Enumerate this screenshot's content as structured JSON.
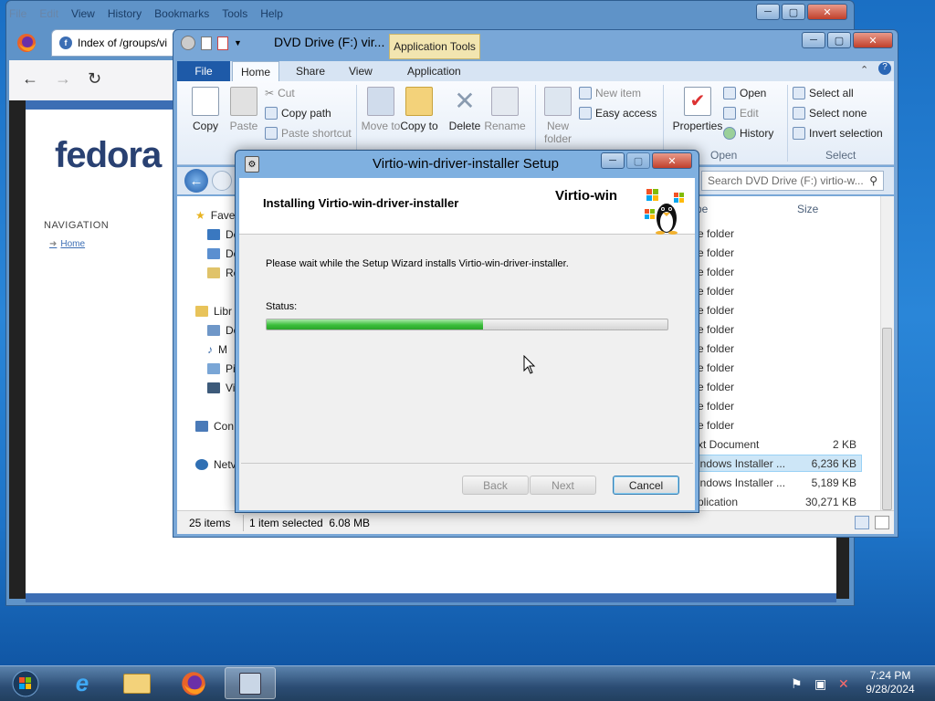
{
  "firefox": {
    "menu": [
      "File",
      "Edit",
      "View",
      "History",
      "Bookmarks",
      "Tools",
      "Help"
    ],
    "tab_title": "Index of /groups/vi",
    "logo_text": "fedora",
    "nav_heading": "NAVIGATION",
    "nav_home": "Home"
  },
  "explorer": {
    "title": "DVD Drive (F:) vir...",
    "app_tools": "Application Tools",
    "tabs": {
      "file": "File",
      "home": "Home",
      "share": "Share",
      "view": "View",
      "application": "Application"
    },
    "ribbon": {
      "copy": "Copy",
      "paste": "Paste",
      "cut": "Cut",
      "copy_path": "Copy path",
      "paste_shortcut": "Paste shortcut",
      "move_to": "Move to",
      "copy_to": "Copy to",
      "delete": "Delete",
      "rename": "Rename",
      "new_folder": "New folder",
      "new_item": "New item",
      "easy_access": "Easy access",
      "properties": "Properties",
      "open": "Open",
      "edit": "Edit",
      "history": "History",
      "select_all": "Select all",
      "select_none": "Select none",
      "invert_selection": "Invert selection",
      "group_open": "Open",
      "group_select": "Select"
    },
    "search_placeholder": "Search DVD Drive (F:) virtio-w...",
    "nav": {
      "favorites": "Fave",
      "desktop": "De",
      "downloads": "Do",
      "recent": "Re",
      "libraries": "Libr",
      "documents": "Do",
      "music": "M",
      "pictures": "Pi",
      "videos": "Vi",
      "computer": "Con",
      "network": "Netv"
    },
    "columns": {
      "type": "pe",
      "size": "Size"
    },
    "rows": [
      {
        "type": "e folder",
        "size": ""
      },
      {
        "type": "e folder",
        "size": ""
      },
      {
        "type": "e folder",
        "size": ""
      },
      {
        "type": "e folder",
        "size": ""
      },
      {
        "type": "e folder",
        "size": ""
      },
      {
        "type": "e folder",
        "size": ""
      },
      {
        "type": "e folder",
        "size": ""
      },
      {
        "type": "e folder",
        "size": ""
      },
      {
        "type": "e folder",
        "size": ""
      },
      {
        "type": "e folder",
        "size": ""
      },
      {
        "type": "e folder",
        "size": ""
      },
      {
        "type": "xt Document",
        "size": "2 KB"
      },
      {
        "type": "indows Installer ...",
        "size": "6,236 KB"
      },
      {
        "type": "indows Installer ...",
        "size": "5,189 KB"
      },
      {
        "type": "plication",
        "size": "30,271 KB"
      }
    ],
    "status_items": "25 items",
    "status_selected": "1 item selected  6.08 MB"
  },
  "dialog": {
    "title": "Virtio-win-driver-installer Setup",
    "heading": "Installing Virtio-win-driver-installer",
    "brand": "Virtio-win",
    "message": "Please wait while the Setup Wizard installs Virtio-win-driver-installer.",
    "status_label": "Status:",
    "progress_percent": 54,
    "back": "Back",
    "next": "Next",
    "cancel": "Cancel"
  },
  "taskbar": {
    "time": "7:24 PM",
    "date": "9/28/2024"
  }
}
